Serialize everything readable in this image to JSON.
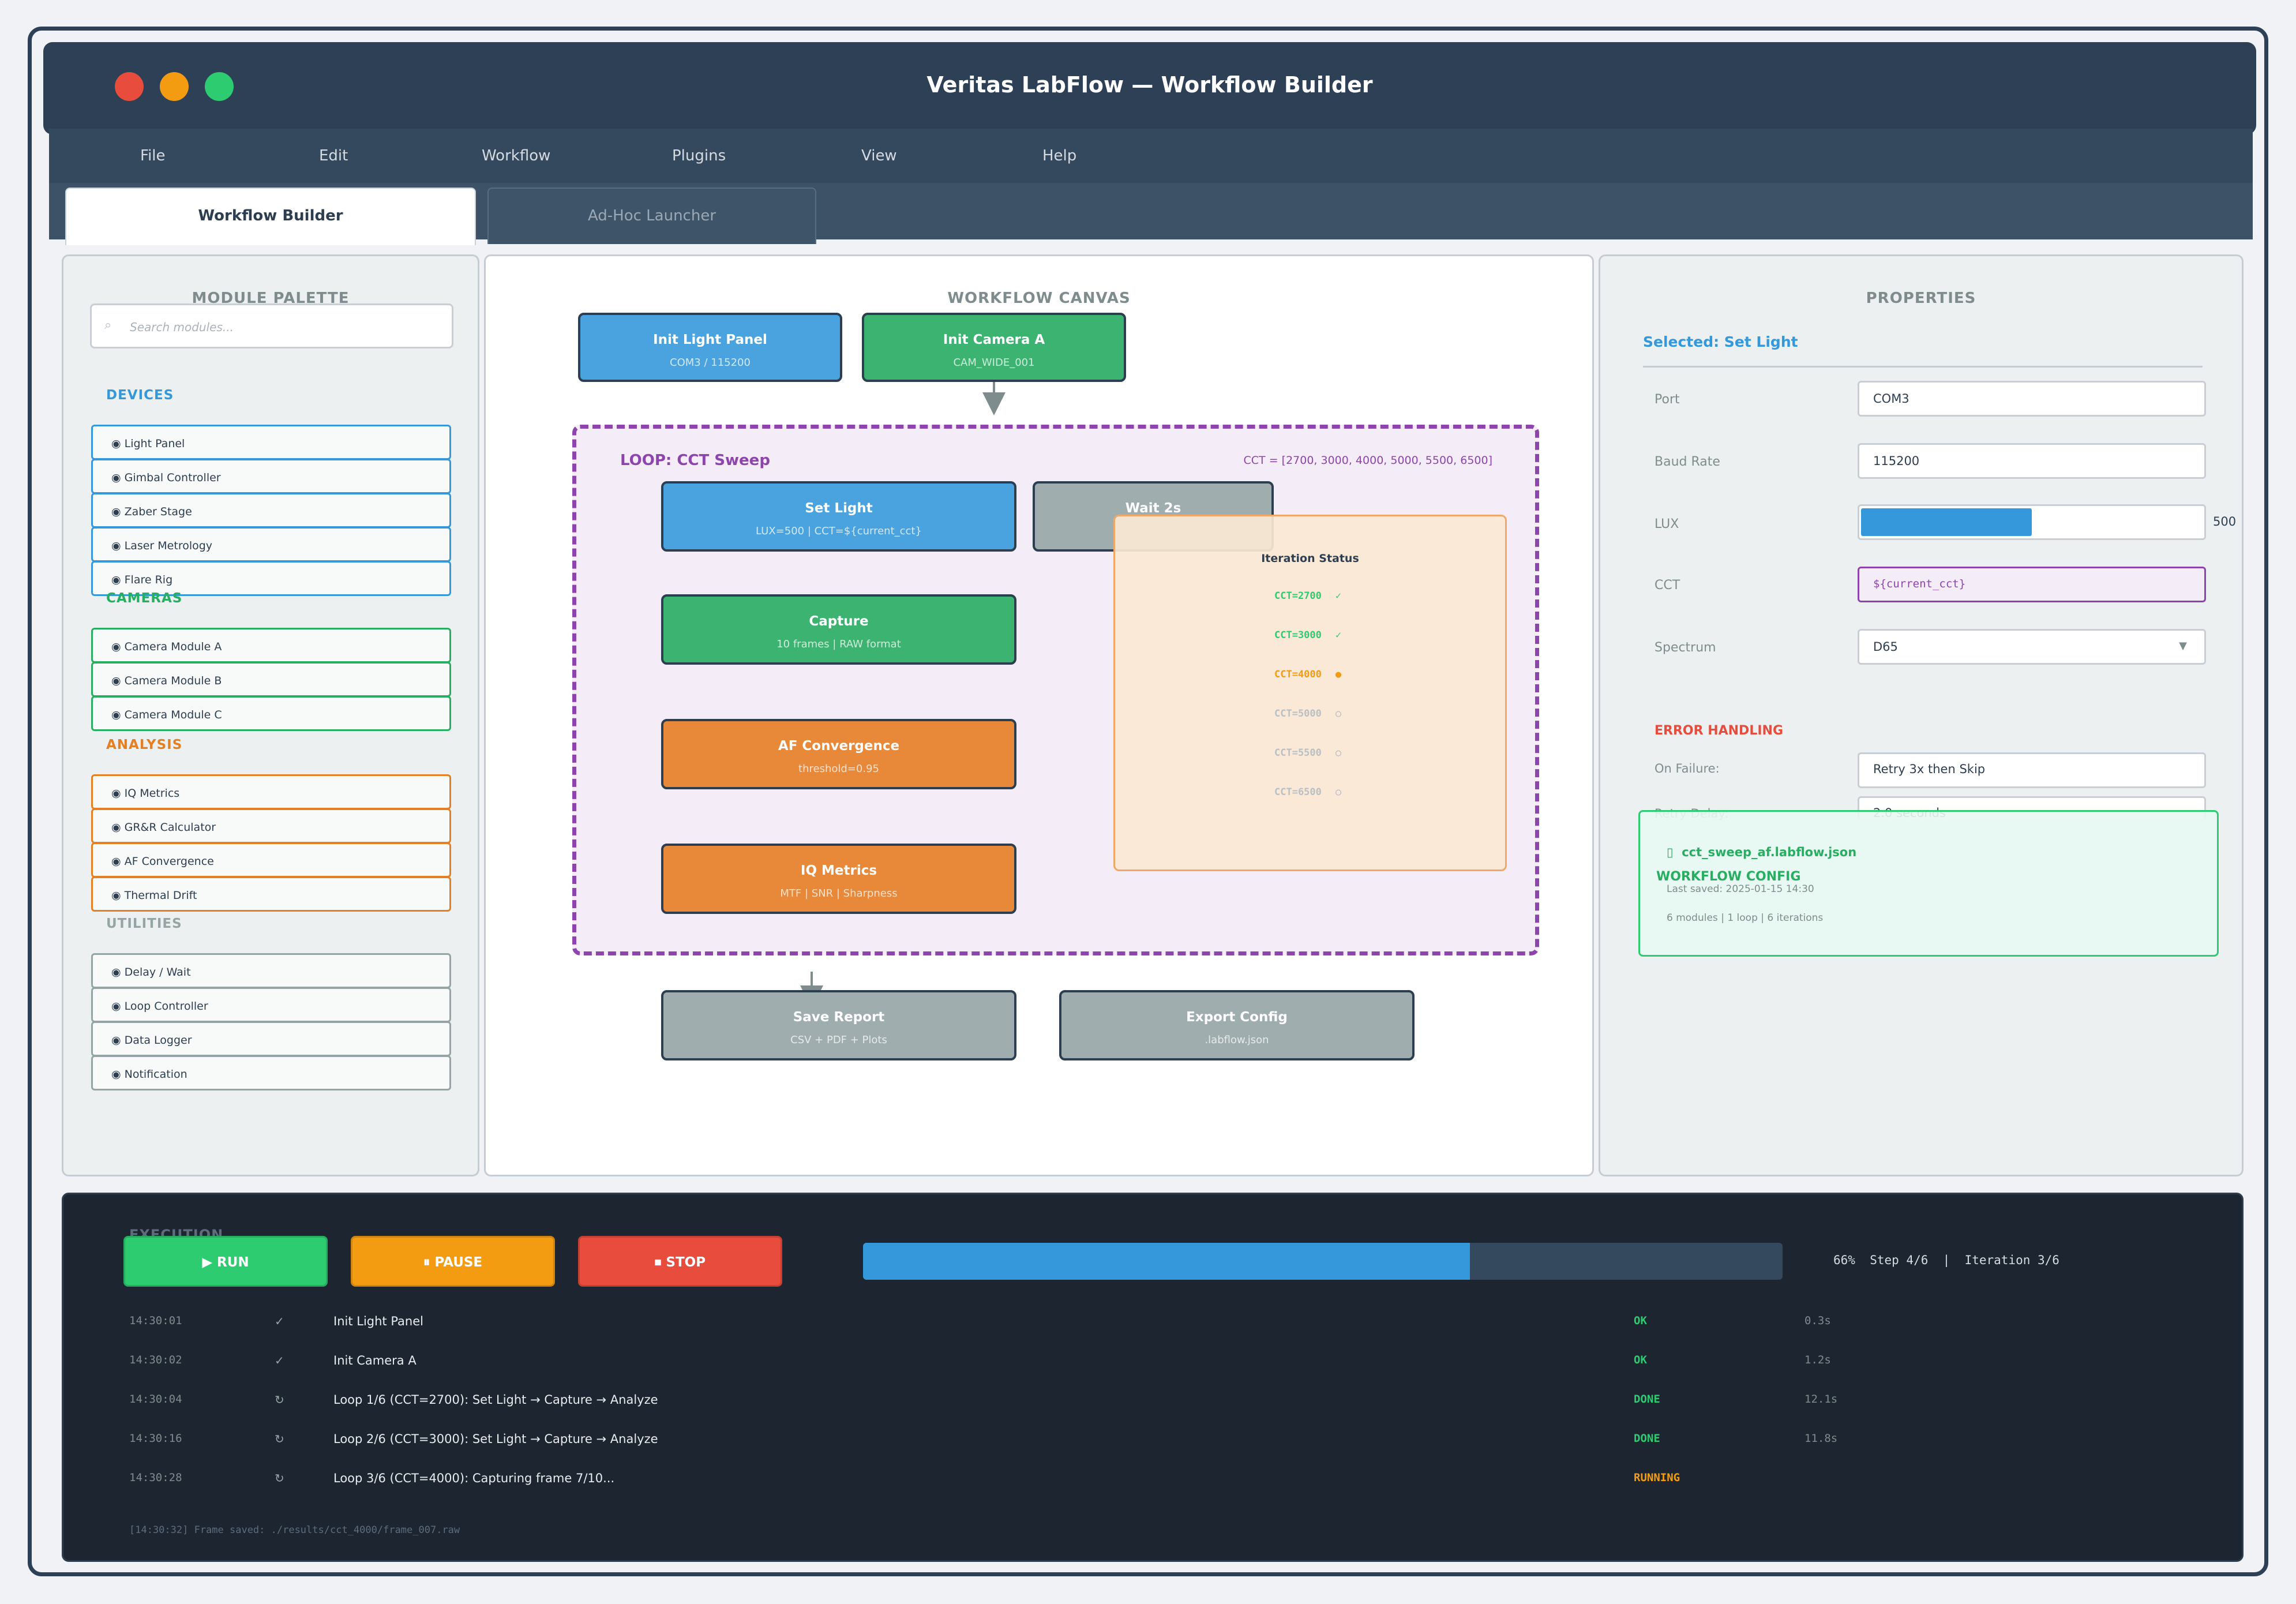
{
  "window": {
    "title": "Veritas LabFlow — Workflow Builder"
  },
  "menu": [
    "File",
    "Edit",
    "Workflow",
    "Plugins",
    "View",
    "Help"
  ],
  "tabs": {
    "active": "Workflow Builder",
    "inactive": "Ad-Hoc Launcher"
  },
  "palette": {
    "title": "MODULE PALETTE",
    "search_placeholder": "Search modules...",
    "categories": [
      {
        "name": "DEVICES",
        "color": "#3498db",
        "items": [
          "◉ Light Panel",
          "◉ Gimbal Controller",
          "◉ Zaber Stage",
          "◉ Laser Metrology",
          "◉ Flare Rig"
        ]
      },
      {
        "name": "CAMERAS",
        "color": "#27ae60",
        "items": [
          "◉ Camera Module A",
          "◉ Camera Module B",
          "◉ Camera Module C"
        ]
      },
      {
        "name": "ANALYSIS",
        "color": "#e67e22",
        "items": [
          "◉ IQ Metrics",
          "◉ GR&R Calculator",
          "◉ AF Convergence",
          "◉ Thermal Drift"
        ]
      },
      {
        "name": "UTILITIES",
        "color": "#95a5a6",
        "items": [
          "◉ Delay / Wait",
          "◉ Loop Controller",
          "◉ Data Logger",
          "◉ Notification"
        ]
      }
    ]
  },
  "canvas": {
    "title": "WORKFLOW CANVAS",
    "nodes": {
      "init_light": {
        "title": "Init Light Panel",
        "sub": "COM3 / 115200"
      },
      "init_camera": {
        "title": "Init Camera A",
        "sub": "CAM_WIDE_001"
      },
      "set_light": {
        "title": "Set Light",
        "sub": "LUX=500 | CCT=${current_cct}"
      },
      "wait": {
        "title": "Wait 2s",
        "sub": ""
      },
      "capture": {
        "title": "Capture",
        "sub": "10 frames | RAW format"
      },
      "af": {
        "title": "AF Convergence",
        "sub": "threshold=0.95"
      },
      "iq": {
        "title": "IQ Metrics",
        "sub": "MTF | SNR | Sharpness"
      },
      "save": {
        "title": "Save Report",
        "sub": "CSV + PDF + Plots"
      },
      "export": {
        "title": "Export Config",
        "sub": ".labflow.json"
      }
    },
    "loop": {
      "title": "LOOP: CCT Sweep",
      "values": "CCT = [2700, 3000, 4000, 5000, 5500, 6500]"
    },
    "iteration_status": {
      "title": "Iteration Status",
      "rows": [
        {
          "label": "CCT=2700",
          "mark": "✓",
          "state": "done"
        },
        {
          "label": "CCT=3000",
          "mark": "✓",
          "state": "done"
        },
        {
          "label": "CCT=4000",
          "mark": "●",
          "state": "running"
        },
        {
          "label": "CCT=5000",
          "mark": "○",
          "state": "pending"
        },
        {
          "label": "CCT=5500",
          "mark": "○",
          "state": "pending"
        },
        {
          "label": "CCT=6500",
          "mark": "○",
          "state": "pending"
        }
      ]
    }
  },
  "properties": {
    "title": "PROPERTIES",
    "selected": "Selected: Set Light",
    "port_label": "Port",
    "port_value": "COM3",
    "baud_label": "Baud Rate",
    "baud_value": "115200",
    "lux_label": "LUX",
    "lux_value": "500",
    "lux_fraction": 0.5,
    "cct_label": "CCT",
    "cct_value": "${current_cct}",
    "spectrum_label": "Spectrum",
    "spectrum_value": "D65",
    "error_title": "ERROR HANDLING",
    "failure_label": "On Failure:",
    "failure_value": "Retry 3x then Skip",
    "retry_label": "Retry Delay:",
    "retry_value": "2.0 seconds",
    "config_title": "WORKFLOW CONFIG",
    "config_file": "cct_sweep_af.labflow.json",
    "config_saved": "Last saved: 2025-01-15 14:30",
    "config_summary": "6 modules | 1 loop | 6 iterations"
  },
  "execution": {
    "title": "EXECUTION",
    "run": "▶ RUN",
    "pause": "⏸ PAUSE",
    "stop": "⏹ STOP",
    "progress": 0.66,
    "progress_text": "66%  Step 4/6  |  Iteration 3/6",
    "log": [
      {
        "time": "14:30:01",
        "icon": "✓",
        "msg": "Init Light Panel",
        "status": "OK",
        "dur": "0.3s",
        "color": "#2ecc71"
      },
      {
        "time": "14:30:02",
        "icon": "✓",
        "msg": "Init Camera A",
        "status": "OK",
        "dur": "1.2s",
        "color": "#2ecc71"
      },
      {
        "time": "14:30:04",
        "icon": "↻",
        "msg": "Loop 1/6 (CCT=2700): Set Light → Capture → Analyze",
        "status": "DONE",
        "dur": "12.1s",
        "color": "#2ecc71"
      },
      {
        "time": "14:30:16",
        "icon": "↻",
        "msg": "Loop 2/6 (CCT=3000): Set Light → Capture → Analyze",
        "status": "DONE",
        "dur": "11.8s",
        "color": "#2ecc71"
      },
      {
        "time": "14:30:28",
        "icon": "↻",
        "msg": "Loop 3/6 (CCT=4000): Capturing frame 7/10...",
        "status": "RUNNING",
        "dur": "",
        "color": "#f39c12"
      }
    ],
    "footer": "[14:30:32] Frame saved: ./results/cct_4000/frame_007.raw"
  },
  "colors": {
    "accent": "#3498db",
    "success": "#2ecc71",
    "warning": "#f39c12",
    "danger": "#e74c3c",
    "loop": "#8e44ad"
  }
}
